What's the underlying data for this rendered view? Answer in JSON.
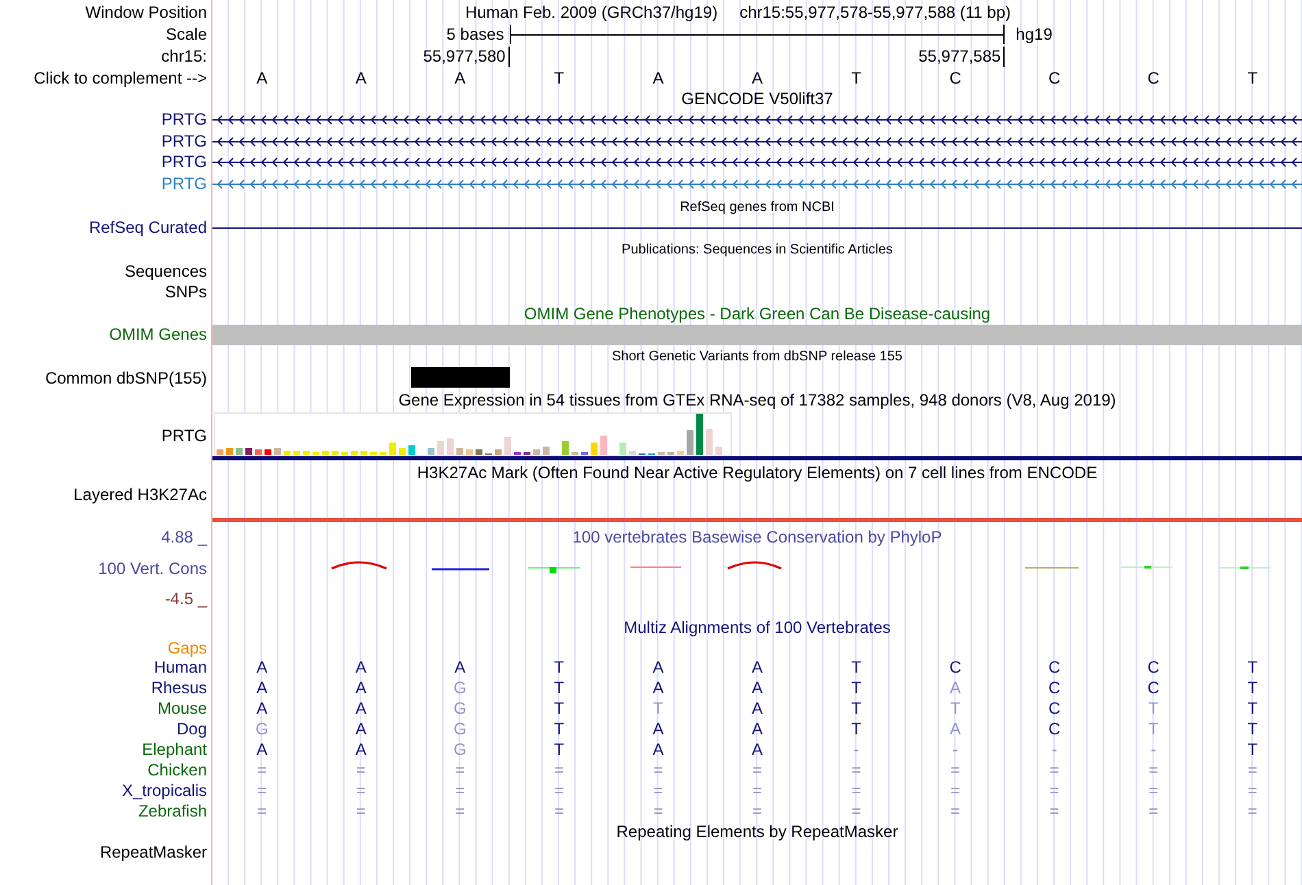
{
  "position_bar": {
    "label": "Window Position",
    "assembly": "Human Feb. 2009 (GRCh37/hg19)",
    "range": "chr15:55,977,578-55,977,588 (11 bp)"
  },
  "scale": {
    "label": "Scale",
    "span": "5 bases",
    "assembly": "hg19"
  },
  "coordinates": {
    "label": "chr15:",
    "start": "55,977,580",
    "end": "55,977,585"
  },
  "sequence": {
    "label": "Click to complement -->",
    "bases": [
      "A",
      "A",
      "A",
      "T",
      "A",
      "A",
      "T",
      "C",
      "C",
      "C",
      "T"
    ]
  },
  "tracks": [
    {
      "kind": "genes",
      "title": "GENCODE V50lift37",
      "genes": [
        {
          "label": "PRTG",
          "color": "#14147a"
        },
        {
          "label": "PRTG",
          "color": "#14147a"
        },
        {
          "label": "PRTG",
          "color": "#14147a"
        },
        {
          "label": "PRTG",
          "color": "#2f80c0"
        }
      ]
    },
    {
      "kind": "line",
      "title": "RefSeq genes from NCBI",
      "label": "RefSeq Curated",
      "color": "#14147a"
    },
    {
      "kind": "empty",
      "title": "Publications: Sequences in Scientific Articles",
      "labels": [
        "Sequences",
        "SNPs"
      ]
    },
    {
      "kind": "band",
      "title": "OMIM Gene Phenotypes - Dark Green Can Be Disease-causing",
      "label": "OMIM Genes",
      "color": "#0a6a0a"
    },
    {
      "kind": "variants",
      "title": "Short Genetic Variants from dbSNP release 155",
      "label": "Common dbSNP(155)"
    },
    {
      "kind": "expression",
      "title": "Gene Expression in 54 tissues from GTEx RNA-seq of 17382 samples, 948 donors (V8, Aug 2019)",
      "label": "PRTG"
    },
    {
      "kind": "signal",
      "title": "H3K27Ac Mark (Often Found Near Active Regulatory Elements) on 7 cell lines from ENCODE",
      "label": "Layered H3K27Ac"
    },
    {
      "kind": "conservation",
      "title": "100 vertebrates Basewise Conservation by PhyloP",
      "label": "100 Vert. Cons",
      "color": "#4a4aa0",
      "max": "4.88 _",
      "min": "-4.5 _"
    },
    {
      "kind": "alignment",
      "title": "Multiz Alignments of 100 Vertebrates",
      "color": "#14147a",
      "gaps_label": "Gaps",
      "species": [
        {
          "name": "Human",
          "color": "#14147a",
          "bases": [
            {
              "base": "A",
              "faded": false
            },
            {
              "base": "A",
              "faded": false
            },
            {
              "base": "A",
              "faded": false
            },
            {
              "base": "T",
              "faded": false
            },
            {
              "base": "A",
              "faded": false
            },
            {
              "base": "A",
              "faded": false
            },
            {
              "base": "T",
              "faded": false
            },
            {
              "base": "C",
              "faded": false
            },
            {
              "base": "C",
              "faded": false
            },
            {
              "base": "C",
              "faded": false
            },
            {
              "base": "T",
              "faded": false
            }
          ]
        },
        {
          "name": "Rhesus",
          "color": "#14147a",
          "bases": [
            {
              "base": "A",
              "faded": false
            },
            {
              "base": "A",
              "faded": false
            },
            {
              "base": "G",
              "faded": true
            },
            {
              "base": "T",
              "faded": false
            },
            {
              "base": "A",
              "faded": false
            },
            {
              "base": "A",
              "faded": false
            },
            {
              "base": "T",
              "faded": false
            },
            {
              "base": "A",
              "faded": true
            },
            {
              "base": "C",
              "faded": false
            },
            {
              "base": "C",
              "faded": false
            },
            {
              "base": "T",
              "faded": false
            }
          ]
        },
        {
          "name": "Mouse",
          "color": "#0a6a0a",
          "bases": [
            {
              "base": "A",
              "faded": false
            },
            {
              "base": "A",
              "faded": false
            },
            {
              "base": "G",
              "faded": true
            },
            {
              "base": "T",
              "faded": false
            },
            {
              "base": "T",
              "faded": true
            },
            {
              "base": "A",
              "faded": false
            },
            {
              "base": "T",
              "faded": false
            },
            {
              "base": "T",
              "faded": true
            },
            {
              "base": "C",
              "faded": false
            },
            {
              "base": "T",
              "faded": true
            },
            {
              "base": "T",
              "faded": false
            }
          ]
        },
        {
          "name": "Dog",
          "color": "#14147a",
          "bases": [
            {
              "base": "G",
              "faded": true
            },
            {
              "base": "A",
              "faded": false
            },
            {
              "base": "G",
              "faded": true
            },
            {
              "base": "T",
              "faded": false
            },
            {
              "base": "A",
              "faded": false
            },
            {
              "base": "A",
              "faded": false
            },
            {
              "base": "T",
              "faded": false
            },
            {
              "base": "A",
              "faded": true
            },
            {
              "base": "C",
              "faded": false
            },
            {
              "base": "T",
              "faded": true
            },
            {
              "base": "T",
              "faded": false
            }
          ]
        },
        {
          "name": "Elephant",
          "color": "#0a6a0a",
          "bases": [
            {
              "base": "A",
              "faded": false
            },
            {
              "base": "A",
              "faded": false
            },
            {
              "base": "G",
              "faded": true
            },
            {
              "base": "T",
              "faded": false
            },
            {
              "base": "A",
              "faded": false
            },
            {
              "base": "A",
              "faded": false
            },
            {
              "base": "-",
              "faded": true
            },
            {
              "base": "-",
              "faded": true
            },
            {
              "base": "-",
              "faded": true
            },
            {
              "base": "-",
              "faded": true
            },
            {
              "base": "T",
              "faded": false
            }
          ]
        },
        {
          "name": "Chicken",
          "color": "#0a6a0a",
          "bases": [
            {
              "base": "=",
              "faded": true
            },
            {
              "base": "=",
              "faded": true
            },
            {
              "base": "=",
              "faded": true
            },
            {
              "base": "=",
              "faded": true
            },
            {
              "base": "=",
              "faded": true
            },
            {
              "base": "=",
              "faded": true
            },
            {
              "base": "=",
              "faded": true
            },
            {
              "base": "=",
              "faded": true
            },
            {
              "base": "=",
              "faded": true
            },
            {
              "base": "=",
              "faded": true
            },
            {
              "base": "=",
              "faded": true
            }
          ]
        },
        {
          "name": "X_tropicalis",
          "color": "#14147a",
          "bases": [
            {
              "base": "=",
              "faded": true
            },
            {
              "base": "=",
              "faded": true
            },
            {
              "base": "=",
              "faded": true
            },
            {
              "base": "=",
              "faded": true
            },
            {
              "base": "=",
              "faded": true
            },
            {
              "base": "=",
              "faded": true
            },
            {
              "base": "=",
              "faded": true
            },
            {
              "base": "=",
              "faded": true
            },
            {
              "base": "=",
              "faded": true
            },
            {
              "base": "=",
              "faded": true
            },
            {
              "base": "=",
              "faded": true
            }
          ]
        },
        {
          "name": "Zebrafish",
          "color": "#0a6a0a",
          "bases": [
            {
              "base": "=",
              "faded": true
            },
            {
              "base": "=",
              "faded": true
            },
            {
              "base": "=",
              "faded": true
            },
            {
              "base": "=",
              "faded": true
            },
            {
              "base": "=",
              "faded": true
            },
            {
              "base": "=",
              "faded": true
            },
            {
              "base": "=",
              "faded": true
            },
            {
              "base": "=",
              "faded": true
            },
            {
              "base": "=",
              "faded": true
            },
            {
              "base": "=",
              "faded": true
            },
            {
              "base": "=",
              "faded": true
            }
          ]
        }
      ]
    },
    {
      "kind": "repeats",
      "title": "Repeating Elements by RepeatMasker",
      "label": "RepeatMasker"
    }
  ]
}
